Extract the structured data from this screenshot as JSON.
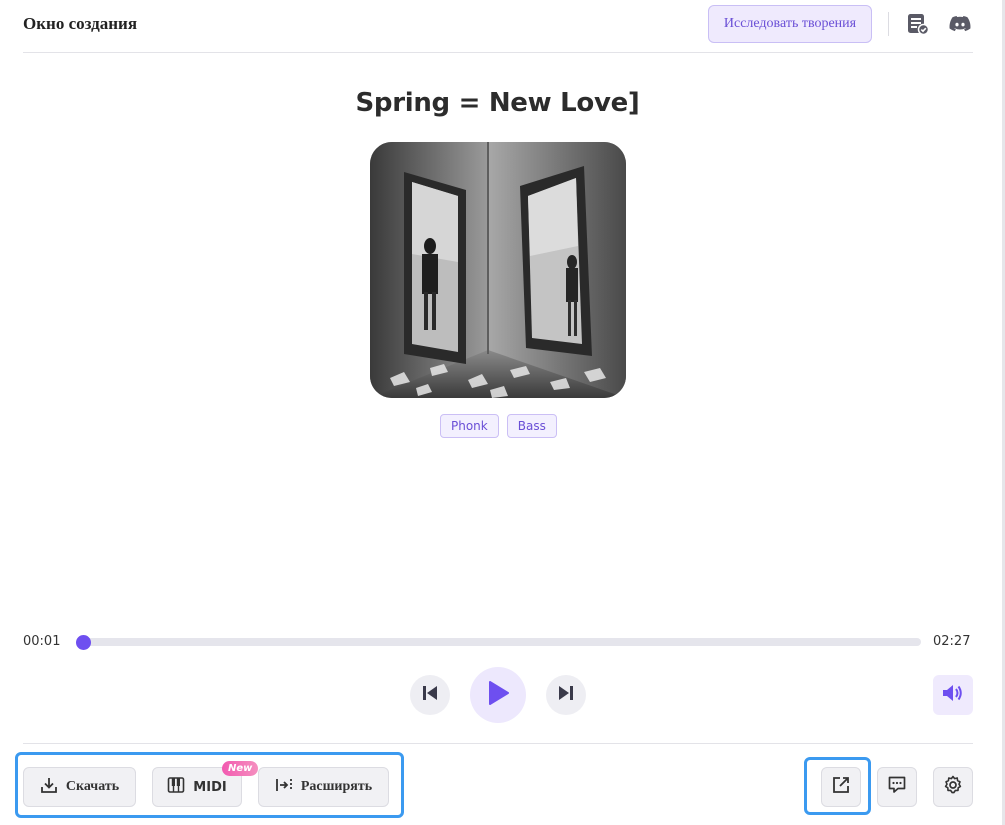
{
  "header": {
    "title": "Окно создания",
    "explore_label": "Исследовать творения",
    "icons": [
      "list-check-icon",
      "discord-icon"
    ]
  },
  "song": {
    "title": "Spring = New Love]",
    "cover_alt": "",
    "tags": [
      "Phonk",
      "Bass"
    ]
  },
  "player": {
    "current_time": "00:01",
    "total_time": "02:27",
    "progress": 0.007,
    "accent": "#6e4ff0"
  },
  "actions": {
    "download_label": "Скачать",
    "midi_label": "MIDI",
    "midi_badge": "New",
    "extend_label": "Расширять"
  },
  "colors": {
    "accent": "#6e4ff0",
    "tag_bg": "#f3f0fe",
    "highlight": "#3b9af0"
  }
}
